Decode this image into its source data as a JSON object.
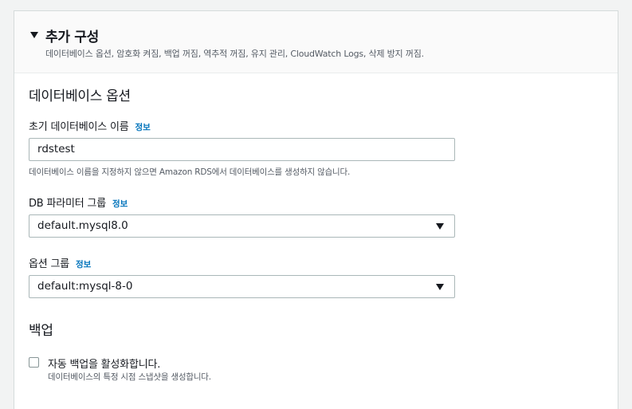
{
  "section": {
    "title": "추가 구성",
    "description": "데이터베이스 옵션, 암호화 켜짐, 백업 꺼짐, 역추적 꺼짐, 유지 관리, CloudWatch Logs, 삭제 방지 꺼짐."
  },
  "db_options": {
    "title": "데이터베이스 옵션",
    "initial_db_name": {
      "label": "초기 데이터베이스 이름",
      "info": "정보",
      "value": "rdstest",
      "hint": "데이터베이스 이름을 지정하지 않으면 Amazon RDS에서 데이터베이스를 생성하지 않습니다."
    },
    "param_group": {
      "label": "DB 파라미터 그룹",
      "info": "정보",
      "value": "default.mysql8.0"
    },
    "option_group": {
      "label": "옵션 그룹",
      "info": "정보",
      "value": "default:mysql-8-0"
    }
  },
  "backup": {
    "title": "백업",
    "auto_backup": {
      "label": "자동 백업을 활성화합니다.",
      "description": "데이터베이스의 특정 시점 스냅샷을 생성합니다.",
      "checked": false
    }
  }
}
